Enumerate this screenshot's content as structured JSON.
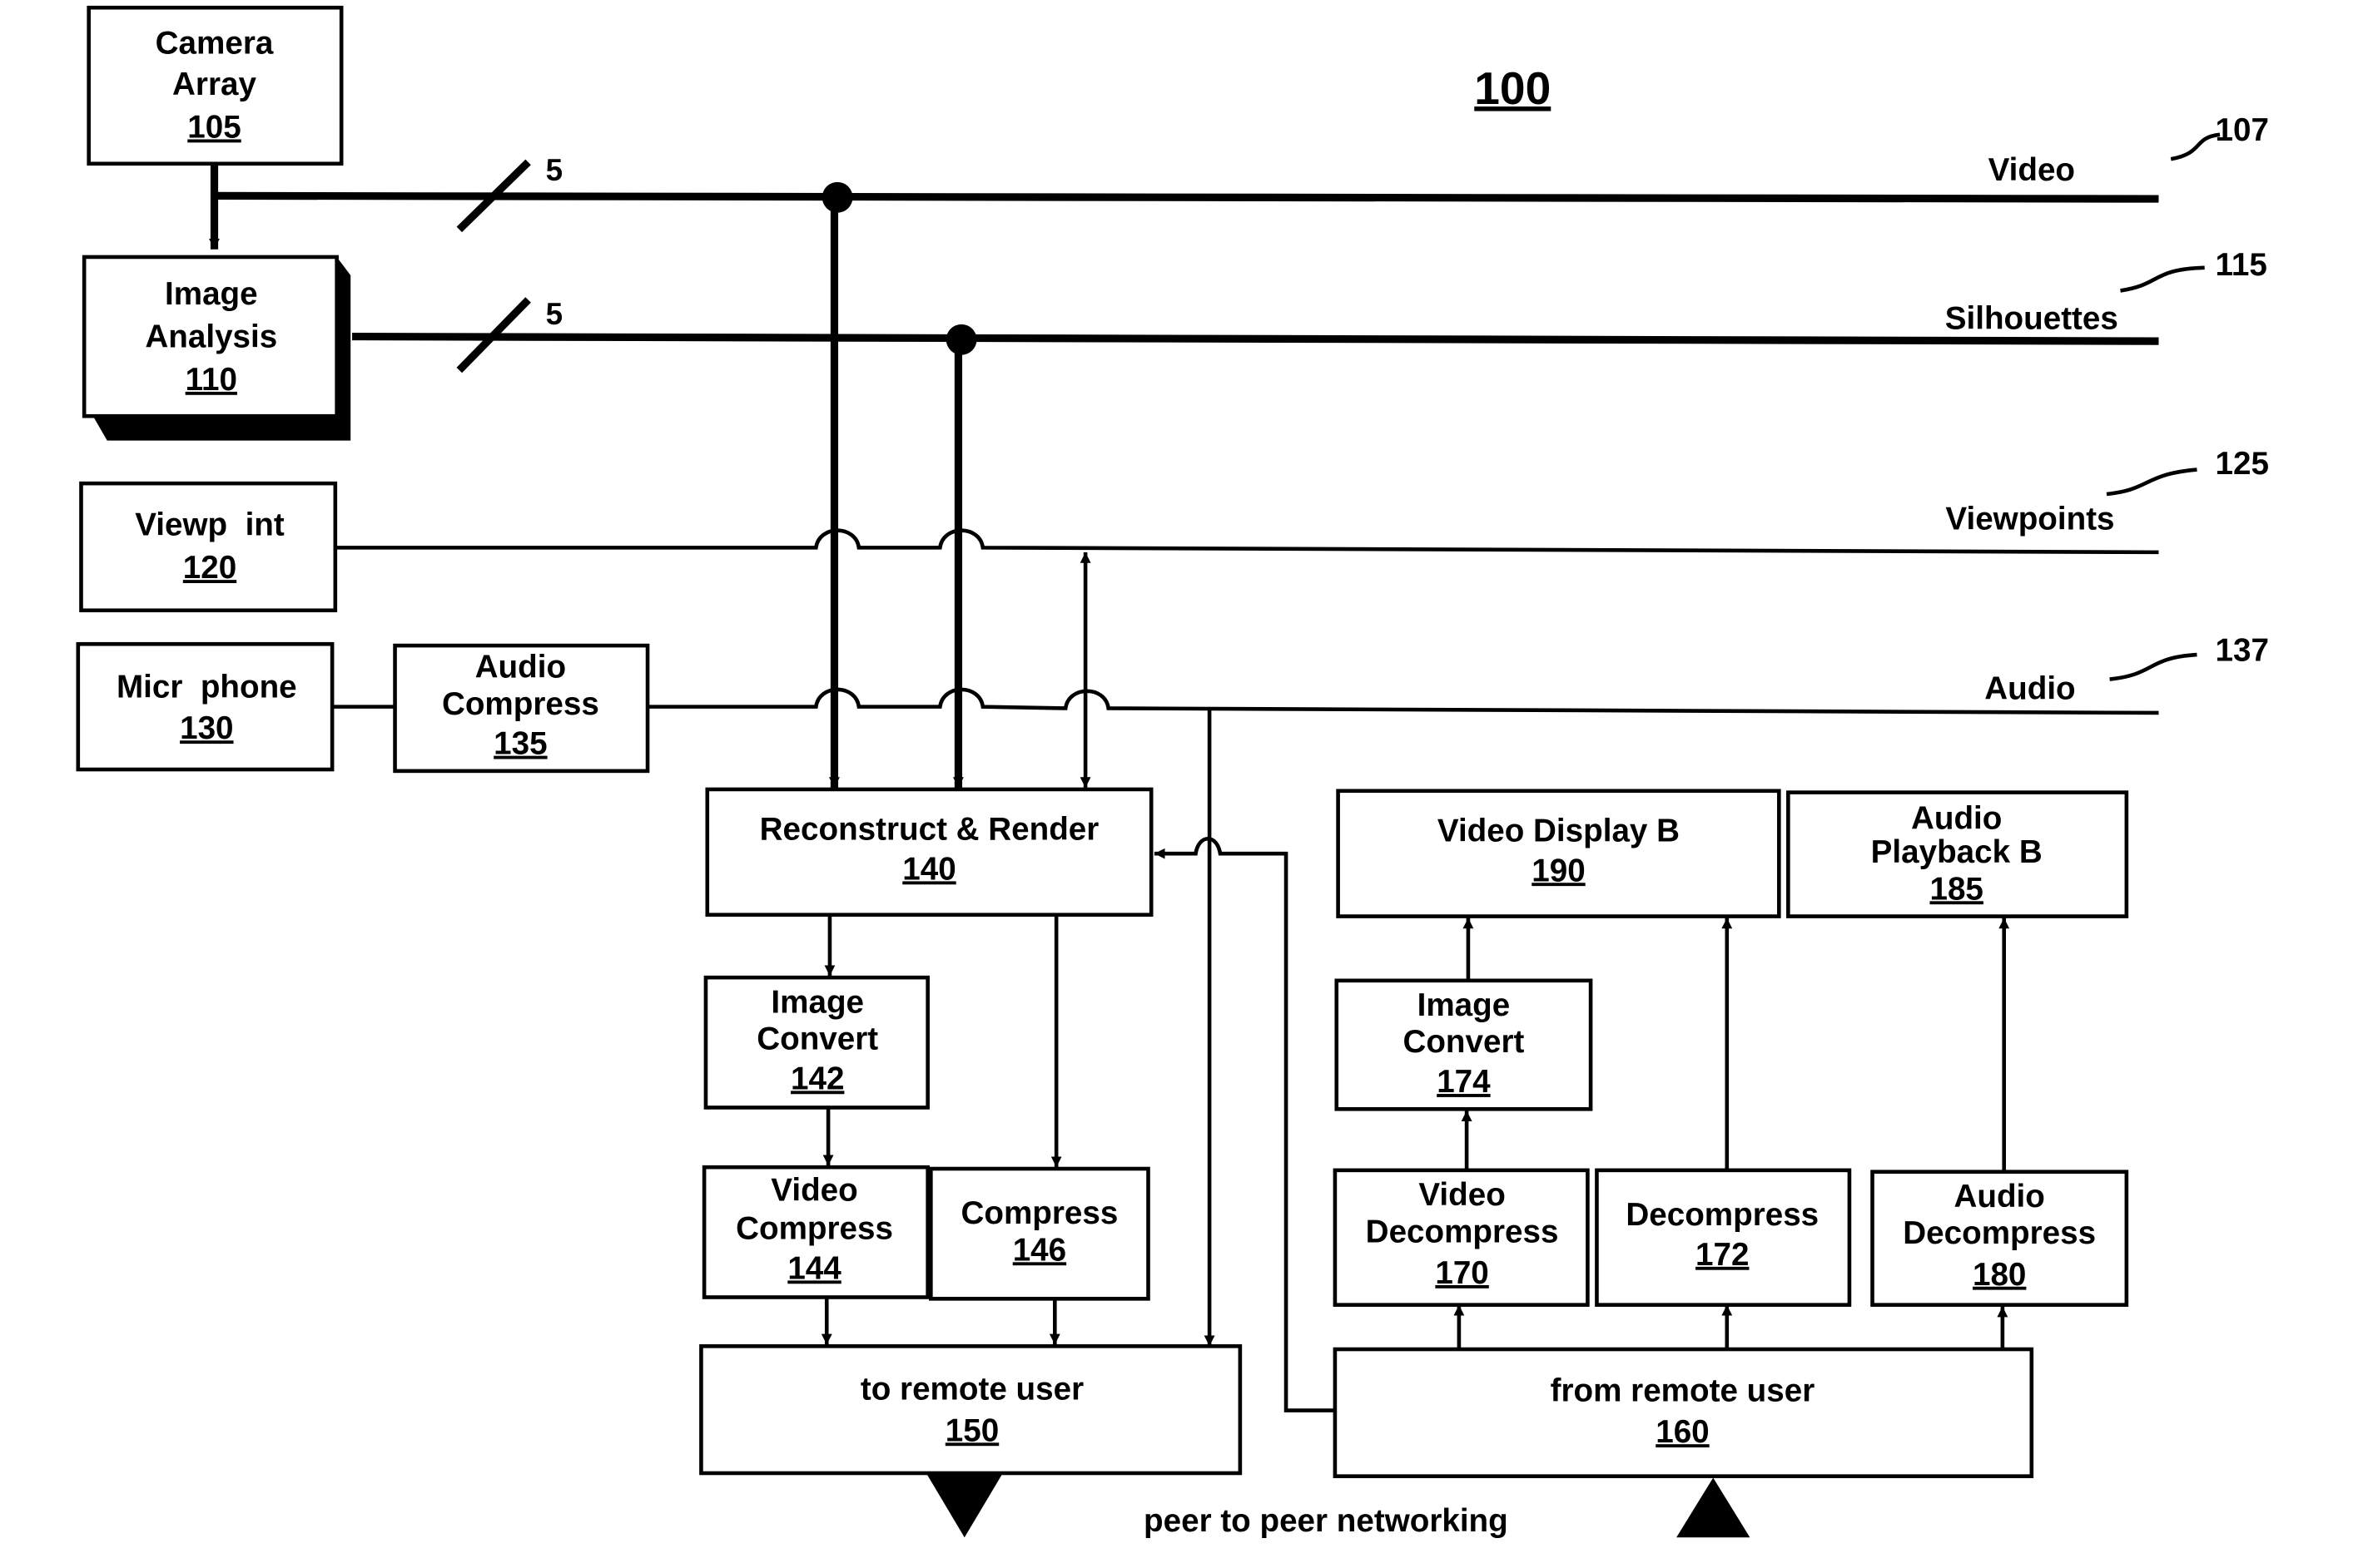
{
  "figure": {
    "number": "100",
    "caption_bottom": "peer to peer networking"
  },
  "buses": [
    {
      "name": "Video",
      "ref": "107",
      "width_mark": "5"
    },
    {
      "name": "Silhouettes",
      "ref": "115",
      "width_mark": "5"
    },
    {
      "name": "Viewpoints",
      "ref": "125"
    },
    {
      "name": "Audio",
      "ref": "137"
    }
  ],
  "blocks": {
    "camera_array": {
      "lines": [
        "Camera",
        "Array"
      ],
      "num": "105"
    },
    "image_analysis": {
      "lines": [
        "Image",
        "Analysis"
      ],
      "num": "110"
    },
    "viewpoint": {
      "lines": [
        "Viewp  int"
      ],
      "num": "120"
    },
    "microphone": {
      "lines": [
        "Micr  phone"
      ],
      "num": "130"
    },
    "audio_compress": {
      "lines": [
        "Audio",
        "Compress"
      ],
      "num": "135"
    },
    "reconstruct_render": {
      "lines": [
        "Reconstruct & Render"
      ],
      "num": "140"
    },
    "image_convert_a": {
      "lines": [
        "Image",
        "Convert"
      ],
      "num": "142"
    },
    "video_compress": {
      "lines": [
        "Video",
        "Compress"
      ],
      "num": "144"
    },
    "compress": {
      "lines": [
        "Compress"
      ],
      "num": "146"
    },
    "to_remote": {
      "lines": [
        "to remote user"
      ],
      "num": "150"
    },
    "from_remote": {
      "lines": [
        "from remote user"
      ],
      "num": "160"
    },
    "video_decompress": {
      "lines": [
        "Video",
        "Decompress"
      ],
      "num": "170"
    },
    "decompress": {
      "lines": [
        "Decompress"
      ],
      "num": "172"
    },
    "image_convert_b": {
      "lines": [
        "Image",
        "Convert"
      ],
      "num": "174"
    },
    "audio_decompress": {
      "lines": [
        "Audio",
        "Decompress"
      ],
      "num": "180"
    },
    "audio_playback": {
      "lines": [
        "Audio",
        "Playback B"
      ],
      "num": "185"
    },
    "video_display": {
      "lines": [
        "Video Display B"
      ],
      "num": "190"
    }
  }
}
